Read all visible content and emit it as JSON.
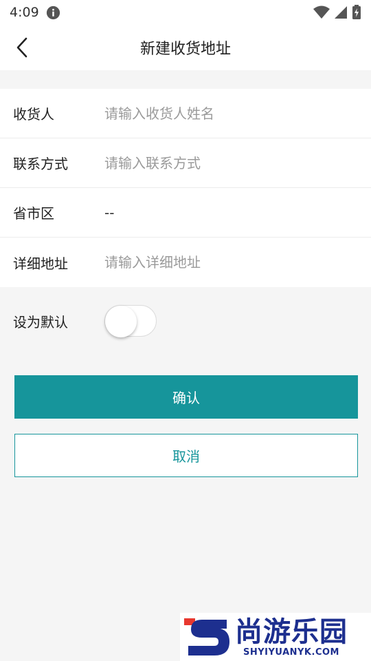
{
  "status_bar": {
    "time": "4:09"
  },
  "header": {
    "title": "新建收货地址"
  },
  "form": {
    "consignee": {
      "label": "收货人",
      "placeholder": "请输入收货人姓名",
      "value": ""
    },
    "contact": {
      "label": "联系方式",
      "placeholder": "请输入联系方式",
      "value": ""
    },
    "region": {
      "label": "省市区",
      "value": "--"
    },
    "address": {
      "label": "详细地址",
      "placeholder": "请输入详细地址",
      "value": ""
    }
  },
  "default_setting": {
    "label": "设为默认",
    "enabled": false
  },
  "actions": {
    "confirm_label": "确认",
    "cancel_label": "取消"
  },
  "watermark": {
    "cn": "尚游乐园",
    "en": "SHYIYUANYK.COM"
  },
  "colors": {
    "accent": "#16959b",
    "background": "#f5f5f5",
    "watermark": "#1d2f8f"
  }
}
